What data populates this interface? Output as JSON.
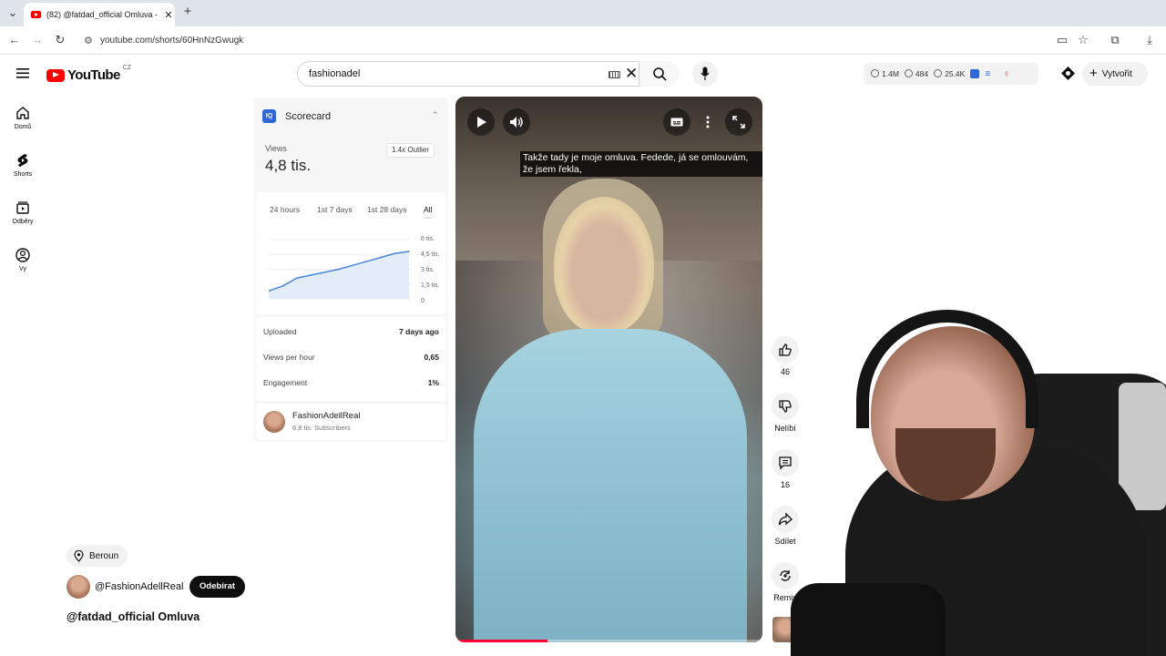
{
  "browser": {
    "tab_title": "(82) @fatdad_official Omluva -",
    "url": "youtube.com/shorts/60HnNzGwugk"
  },
  "masthead": {
    "logo_text": "YouTube",
    "region": "CZ",
    "search_value": "fashionadel",
    "stats": {
      "views": "1.4M",
      "watching": "484",
      "other": "25.4K"
    },
    "create_label": "Vytvořit"
  },
  "guide": {
    "items": [
      {
        "label": "Domů",
        "icon": "home-icon"
      },
      {
        "label": "Shorts",
        "icon": "shorts-icon"
      },
      {
        "label": "Odběry",
        "icon": "subscriptions-icon"
      },
      {
        "label": "Vy",
        "icon": "account-icon"
      }
    ]
  },
  "scorecard": {
    "logo": "IQ",
    "title": "Scorecard",
    "views_label": "Views",
    "views_value": "4,8 tis.",
    "outlier": "1.4x Outlier",
    "tabs": [
      "24 hours",
      "1st 7 days",
      "1st 28 days",
      "All"
    ],
    "active_tab": "All",
    "y_ticks": [
      "6 tis.",
      "4,5 tis.",
      "3 tis.",
      "1,5 tis.",
      "0"
    ],
    "rows": [
      {
        "label": "Uploaded",
        "value": "7 days ago"
      },
      {
        "label": "Views per hour",
        "value": "0,65"
      },
      {
        "label": "Engagement",
        "value": "1%"
      }
    ],
    "channel_name": "FashionAdellReal",
    "channel_subs": "6,8 tis. Subscribers"
  },
  "chart_data": {
    "type": "area",
    "x": [
      0,
      1,
      2,
      3,
      4,
      5,
      6,
      7,
      8,
      9,
      10
    ],
    "values": [
      800,
      1300,
      2100,
      2400,
      2700,
      3000,
      3400,
      3800,
      4200,
      4600,
      4800
    ],
    "ylim": [
      0,
      6000
    ],
    "y_ticks": [
      "6 tis.",
      "4,5 tis.",
      "3 tis.",
      "1,5 tis.",
      "0"
    ],
    "grid": true,
    "color": "#4a86d9"
  },
  "video": {
    "subtitle": "Takže tady je moje omluva. Fedede, já se omlouvám, že jsem řekla,",
    "progress": 0.3
  },
  "actions": {
    "like_count": "46",
    "dislike_label": "Nelíbí",
    "comments_count": "16",
    "share_label": "Sdílet",
    "remix_label": "Remix"
  },
  "info": {
    "location": "Beroun",
    "uploader": "@FashionAdellReal",
    "subscribe_label": "Odebírat",
    "title": "@fatdad_official Omluva"
  },
  "colors": {
    "brand": "#ff0000",
    "iq_blue": "#2f67d8"
  }
}
